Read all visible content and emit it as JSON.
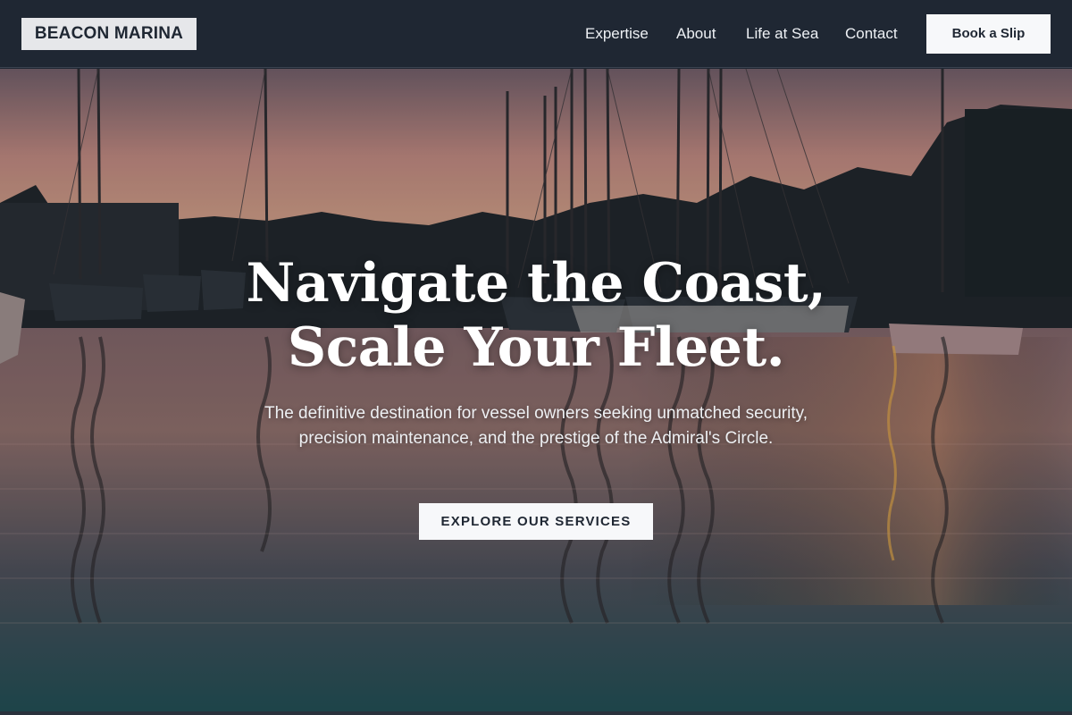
{
  "header": {
    "logo": "BEACON MARINA",
    "nav": [
      {
        "label": "Expertise"
      },
      {
        "label": "About"
      },
      {
        "label": "Life at Sea"
      },
      {
        "label": "Contact"
      }
    ],
    "cta_label": "Book a Slip"
  },
  "hero": {
    "headline_line1": "Navigate the Coast,",
    "headline_line2": "Scale Your Fleet.",
    "subtext": "The definitive destination for vessel owners seeking unmatched security, precision maintenance, and the prestige of the Admiral's Circle.",
    "button_label": "EXPLORE OUR SERVICES",
    "background_image": "marina-sunset-photo"
  },
  "colors": {
    "header_bg": "#1f2733",
    "button_bg": "#f7f8fa",
    "button_text": "#1f2733",
    "sky_top": "#b9837a",
    "water_bottom": "#1f4a4f"
  }
}
